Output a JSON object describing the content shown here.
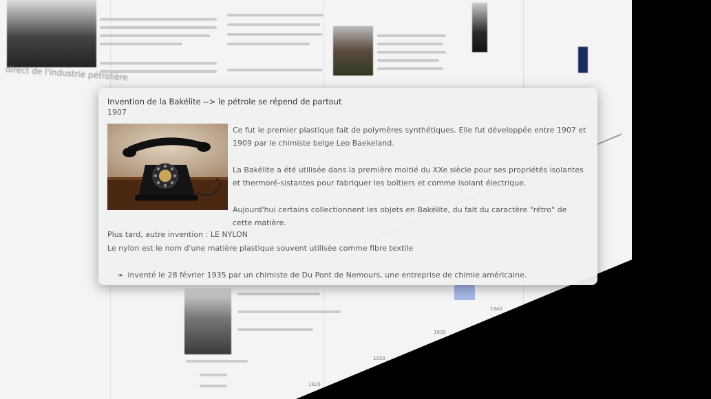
{
  "background": {
    "left_intro_partial": "direct de l'industrie pétrolière",
    "axis_ticks": [
      "1925",
      "1930",
      "1935",
      "1940"
    ]
  },
  "popup": {
    "title": "Invention de la Bakélite --> le pétrole se répend de partout",
    "year": "1907",
    "image_alt": "telephone-bakelite",
    "paragraph1": "Ce fut le premier plastique fait de polymères synthétiques. Elle fut développée entre 1907 et 1909 par le chimiste belge Leo Baekeland.",
    "paragraph2": "La Bakélite a été utilisée dans la première moitié du XXe siècle pour ses propriétés isolantes et thermoré-sistantes pour fabriquer les boîtiers et comme isolant électrique.",
    "paragraph3": "Aujourd'hui certains collectionnent les objets en Bakélite, du fait du caractère \"rétro\" de cette matière.",
    "later_invention": "Plus tard, autre invention : LE NYLON",
    "nylon_description": "Le nylon est le nom d'une matière plastique souvent utilisée comme fibre textile",
    "bullet_icon": "leaf-bullet-icon",
    "bullet_text": "inventé le 28 février 1935 par un chimiste de Du Pont de Nemours,   une entreprise de chimie américaine."
  }
}
